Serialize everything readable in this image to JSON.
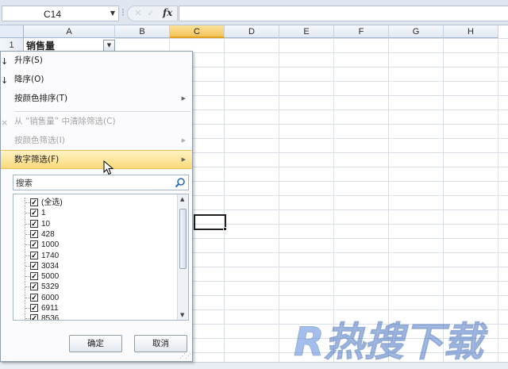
{
  "formula_bar": {
    "name_box": "C14",
    "formula": ""
  },
  "grid": {
    "columns": [
      "A",
      "B",
      "C",
      "D",
      "E",
      "F",
      "G",
      "H"
    ],
    "selected_column": "C",
    "rows": [
      "1"
    ],
    "cell_a1": "销售量",
    "active_cell": "C14"
  },
  "filter_menu": {
    "items": [
      {
        "label": "升序(S)",
        "enabled": true,
        "submenu": false,
        "icon": "sort-ascending-icon"
      },
      {
        "label": "降序(O)",
        "enabled": true,
        "submenu": false,
        "icon": "sort-descending-icon"
      },
      {
        "label": "按颜色排序(T)",
        "enabled": true,
        "submenu": true
      },
      {
        "label": "从 “销售量” 中清除筛选(C)",
        "enabled": false,
        "submenu": false,
        "icon": "clear-filter-icon"
      },
      {
        "label": "按颜色筛选(I)",
        "enabled": false,
        "submenu": true
      },
      {
        "label": "数字筛选(F)",
        "enabled": true,
        "submenu": true,
        "highlighted": true
      }
    ],
    "search_placeholder": "搜索",
    "checklist": [
      {
        "label": "(全选)",
        "checked": true
      },
      {
        "label": "1",
        "checked": true
      },
      {
        "label": "10",
        "checked": true
      },
      {
        "label": "428",
        "checked": true
      },
      {
        "label": "1000",
        "checked": true
      },
      {
        "label": "1740",
        "checked": true
      },
      {
        "label": "3034",
        "checked": true
      },
      {
        "label": "5000",
        "checked": true
      },
      {
        "label": "5329",
        "checked": true
      },
      {
        "label": "6000",
        "checked": true
      },
      {
        "label": "6911",
        "checked": true
      },
      {
        "label": "8536",
        "checked": true
      }
    ],
    "ok_label": "确定",
    "cancel_label": "取消"
  },
  "watermark": {
    "text": "R热搜下载",
    "color": "#4a7fd6"
  },
  "colors": {
    "selected_header": "#f4c35a",
    "menu_highlight": "#fbd97a"
  }
}
